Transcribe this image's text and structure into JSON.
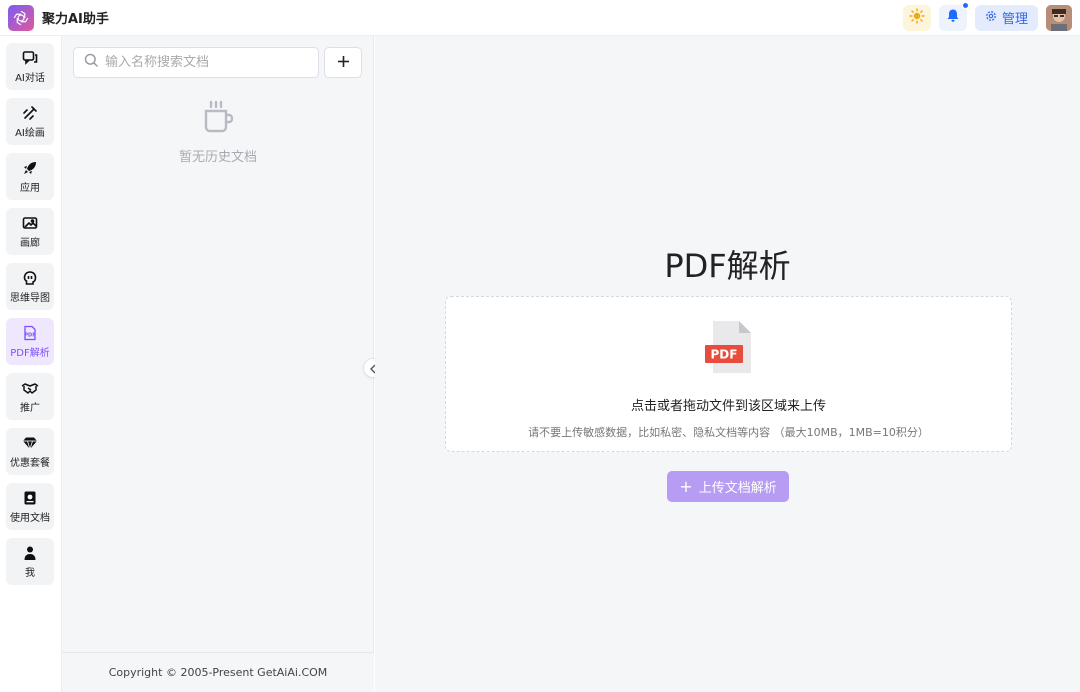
{
  "app": {
    "title": "聚力AI助手",
    "colors": {
      "accent": "#7c4dff",
      "upload_button": "#b69cf3",
      "admin_text": "#2f6ae8",
      "notification_dot": "#1f6bff"
    }
  },
  "header": {
    "theme_icon": "sun-icon",
    "bell_icon": "bell-icon",
    "admin_label": "管理",
    "admin_icon": "gear-icon"
  },
  "nav": {
    "items": [
      {
        "id": "chat",
        "label": "AI对话",
        "icon": "chat-icon",
        "active": false
      },
      {
        "id": "draw",
        "label": "AI绘画",
        "icon": "brush-icon",
        "active": false
      },
      {
        "id": "apps",
        "label": "应用",
        "icon": "rocket-icon",
        "active": false
      },
      {
        "id": "gallery",
        "label": "画廊",
        "icon": "image-icon",
        "active": false
      },
      {
        "id": "mindmap",
        "label": "思维导图",
        "icon": "brain-icon",
        "active": false
      },
      {
        "id": "pdf",
        "label": "PDF解析",
        "icon": "pdf-icon",
        "active": true
      },
      {
        "id": "promote",
        "label": "推广",
        "icon": "handshake-icon",
        "active": false
      },
      {
        "id": "plans",
        "label": "优惠套餐",
        "icon": "diamond-icon",
        "active": false
      },
      {
        "id": "docs",
        "label": "使用文档",
        "icon": "book-icon",
        "active": false
      },
      {
        "id": "me",
        "label": "我",
        "icon": "user-icon",
        "active": false
      }
    ]
  },
  "doc_panel": {
    "search_placeholder": "输入名称搜索文档",
    "add_label": "+",
    "empty_text": "暂无历史文档",
    "copyright": "Copyright © 2005-Present GetAiAi.COM"
  },
  "main": {
    "title": "PDF解析",
    "drop_title": "点击或者拖动文件到该区域来上传",
    "drop_hint": "请不要上传敏感数据，比如私密、隐私文档等内容 （最大10MB，1MB=10积分）",
    "pdf_badge": "PDF",
    "upload_button": "上传文档解析",
    "upload_plus": "+"
  }
}
